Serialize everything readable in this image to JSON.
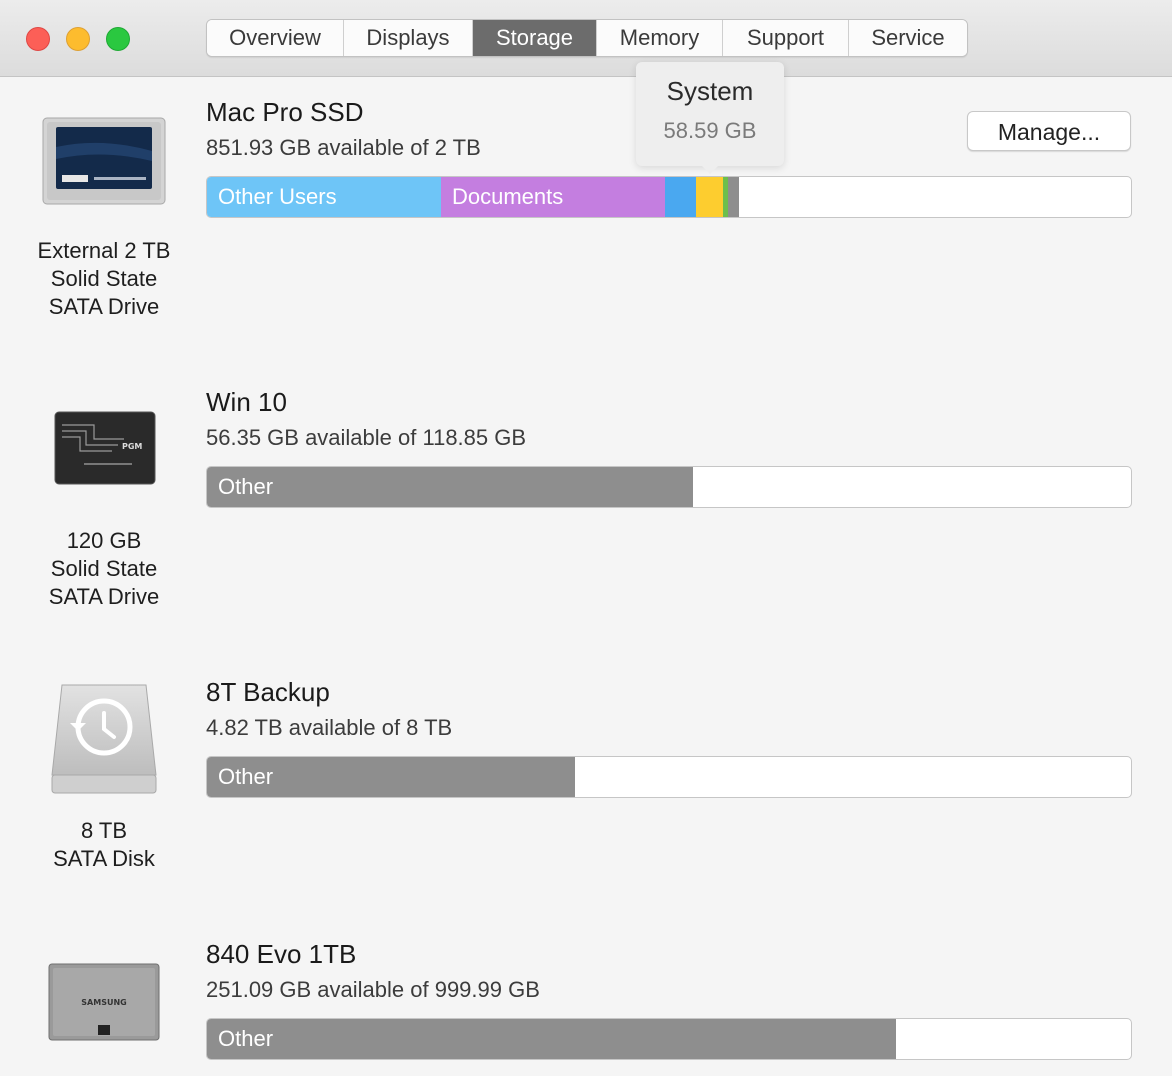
{
  "window": {
    "tabs": [
      {
        "label": "Overview"
      },
      {
        "label": "Displays"
      },
      {
        "label": "Storage",
        "active": true
      },
      {
        "label": "Memory"
      },
      {
        "label": "Support"
      },
      {
        "label": "Service"
      }
    ]
  },
  "tooltip": {
    "title": "System",
    "value": "58.59 GB"
  },
  "manage_button": "Manage...",
  "colors": {
    "other_users": "#6ec5f7",
    "documents": "#c47ee0",
    "apps": "#4aa8f0",
    "system": "#fdcd2f",
    "misc": "#6cbf4c",
    "other": "#8e8e8e"
  },
  "drives": [
    {
      "name": "Mac Pro SSD",
      "available": "851.93 GB available of 2 TB",
      "description": [
        "External 2 TB",
        "Solid State",
        "SATA Drive"
      ],
      "icon": "crucial-ssd-icon",
      "segments": [
        {
          "label": "Other Users",
          "fraction": 0.253,
          "color": "#6ec5f7"
        },
        {
          "label": "Documents",
          "fraction": 0.242,
          "color": "#c47ee0"
        },
        {
          "label": "",
          "fraction": 0.034,
          "color": "#4aa8f0"
        },
        {
          "label": "",
          "fraction": 0.029,
          "color": "#fdcd2f"
        },
        {
          "label": "",
          "fraction": 0.005,
          "color": "#6cbf4c"
        },
        {
          "label": "",
          "fraction": 0.004,
          "color": "#8e8e8e"
        }
      ]
    },
    {
      "name": "Win 10",
      "available": "56.35 GB available of 118.85 GB",
      "description": [
        "120 GB",
        "Solid State",
        "SATA Drive"
      ],
      "icon": "pgm-ssd-icon",
      "segments": [
        {
          "label": "Other",
          "fraction": 0.526,
          "color": "#8e8e8e"
        }
      ]
    },
    {
      "name": "8T Backup",
      "available": "4.82 TB available of 8 TB",
      "description": [
        "8 TB",
        "SATA Disk"
      ],
      "icon": "time-machine-disk-icon",
      "segments": [
        {
          "label": "Other",
          "fraction": 0.398,
          "color": "#8e8e8e"
        }
      ]
    },
    {
      "name": "840 Evo 1TB",
      "available": "251.09 GB available of 999.99 GB",
      "description": [],
      "icon": "samsung-ssd-icon",
      "segments": [
        {
          "label": "Other",
          "fraction": 0.746,
          "color": "#8e8e8e"
        }
      ]
    }
  ]
}
